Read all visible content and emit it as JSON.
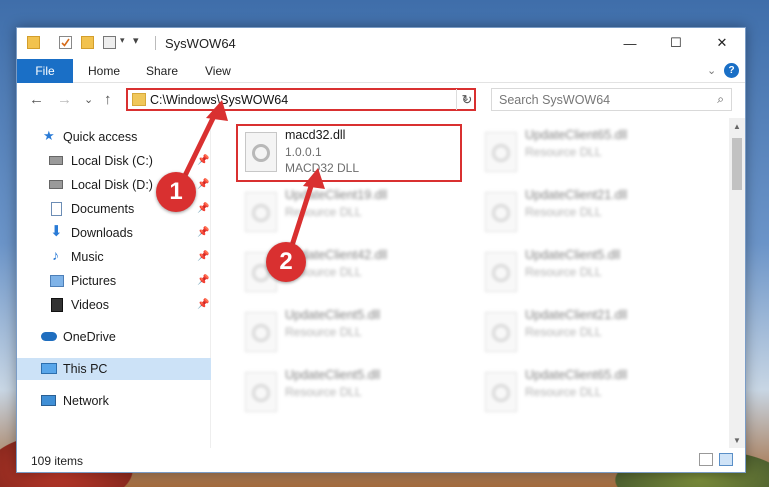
{
  "window": {
    "title": "SysWOW64",
    "minimize_glyph": "—",
    "maximize_glyph": "☐",
    "close_glyph": "✕"
  },
  "ribbon": {
    "tabs": [
      "File",
      "Home",
      "Share",
      "View"
    ],
    "expand_glyph": "⌄",
    "help_glyph": "?"
  },
  "navigation": {
    "back_glyph": "←",
    "forward_glyph": "→",
    "recent_glyph": "⌄",
    "up_glyph": "↑",
    "address": "C:\\Windows\\SysWOW64",
    "refresh_glyph": "↻",
    "search_placeholder": "Search SysWOW64"
  },
  "sidebar": {
    "items": [
      {
        "label": "Quick access",
        "icon": "star-icon",
        "pinned": false
      },
      {
        "label": "Local Disk (C:)",
        "icon": "drive-icon",
        "pinned": true
      },
      {
        "label": "Local Disk (D:)",
        "icon": "drive-icon",
        "pinned": true
      },
      {
        "label": "Documents",
        "icon": "documents-icon",
        "pinned": true
      },
      {
        "label": "Downloads",
        "icon": "download-icon",
        "pinned": true
      },
      {
        "label": "Music",
        "icon": "music-icon",
        "pinned": true
      },
      {
        "label": "Pictures",
        "icon": "pictures-icon",
        "pinned": true
      },
      {
        "label": "Videos",
        "icon": "videos-icon",
        "pinned": true
      },
      {
        "label": "OneDrive",
        "icon": "cloud-icon",
        "pinned": false
      },
      {
        "label": "This PC",
        "icon": "computer-icon",
        "pinned": false,
        "selected": true
      },
      {
        "label": "Network",
        "icon": "network-icon",
        "pinned": false
      }
    ]
  },
  "files": {
    "main": {
      "name": "macd32.dll",
      "version": "1.0.0.1",
      "description": "MACD32 DLL"
    },
    "left_column": [
      {
        "name": "UpdateClient19.dll",
        "type": "Resource DLL"
      },
      {
        "name": "UpdateClient42.dll",
        "type": "Resource DLL"
      },
      {
        "name": "UpdateClient5.dll",
        "type": "Resource DLL"
      },
      {
        "name": "UpdateClient5.dll",
        "type": "Resource DLL"
      }
    ],
    "right_column": [
      {
        "name": "UpdateClient65.dll",
        "type": "Resource DLL"
      },
      {
        "name": "UpdateClient21.dll",
        "type": "Resource DLL"
      },
      {
        "name": "UpdateClient5.dll",
        "type": "Resource DLL"
      },
      {
        "name": "UpdateClient21.dll",
        "type": "Resource DLL"
      },
      {
        "name": "UpdateClient65.dll",
        "type": "Resource DLL"
      }
    ]
  },
  "status": {
    "item_count": "109 items"
  },
  "callouts": {
    "one": "1",
    "two": "2"
  },
  "colors": {
    "accent": "#1a6fc6",
    "callout": "#d93030",
    "selection": "#cce2f7"
  }
}
